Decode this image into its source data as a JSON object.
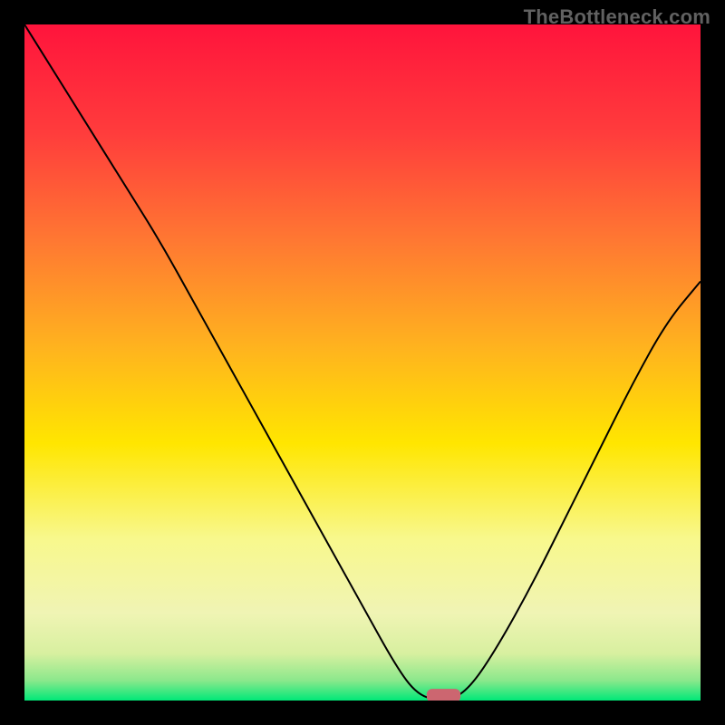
{
  "watermark": "TheBottleneck.com",
  "chart_data": {
    "type": "line",
    "title": "",
    "xlabel": "",
    "ylabel": "",
    "xlim": [
      0,
      100
    ],
    "ylim": [
      0,
      100
    ],
    "grid": false,
    "legend": false,
    "gradient_colors": {
      "top": "#ff143c",
      "mid": "#ffe600",
      "bottom": "#00e878"
    },
    "x": [
      0,
      5,
      10,
      15,
      20,
      25,
      30,
      35,
      40,
      45,
      50,
      55,
      58,
      61,
      63,
      66,
      70,
      75,
      80,
      85,
      90,
      95,
      100
    ],
    "y": [
      100,
      92,
      84,
      76,
      68,
      59,
      50,
      41,
      32,
      23,
      14,
      5,
      1,
      0,
      0,
      2,
      8,
      17,
      27,
      37,
      47,
      56,
      62
    ],
    "marker": {
      "x": 62,
      "y": 0,
      "color": "#cc6670",
      "w": 5,
      "h": 2
    },
    "annotations": []
  }
}
